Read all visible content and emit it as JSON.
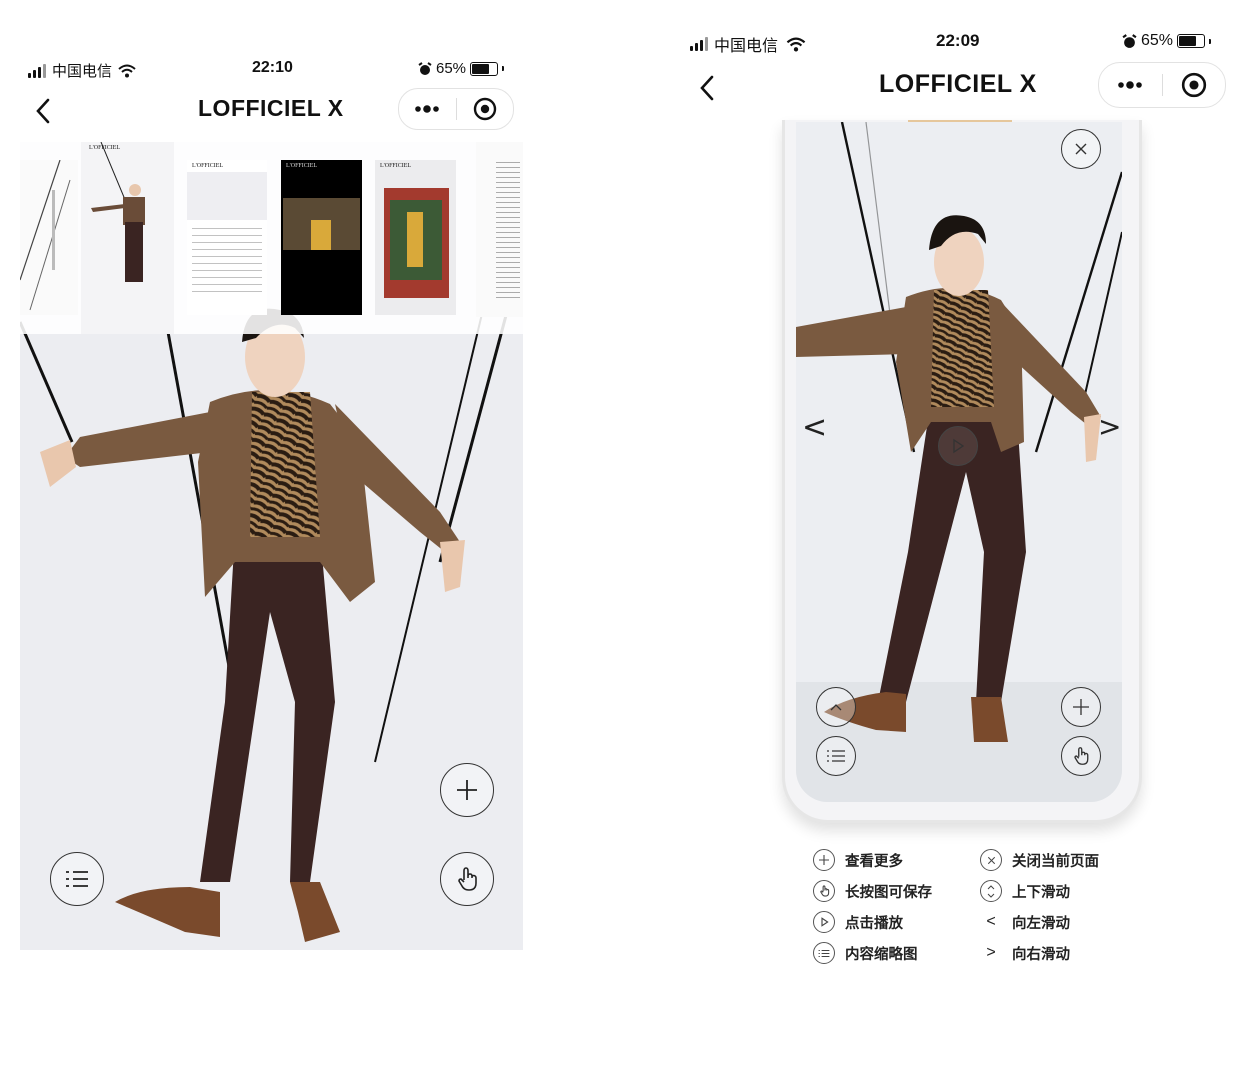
{
  "left": {
    "status": {
      "carrier": "中国电信",
      "time": "22:10",
      "battery": "65%",
      "battery_level": 0.65
    },
    "nav": {
      "title": "LOFFICIEL X"
    },
    "thumbnail_strip": {
      "pages": [
        {
          "label": "L'OFFICIEL"
        },
        {
          "label": "L'OFFICIEL"
        },
        {
          "label": "L'OFFICIEL"
        },
        {
          "label": "L'OFFICIEL"
        }
      ]
    },
    "controls": [
      "plus-button",
      "menu-button",
      "hand-save-button"
    ]
  },
  "right": {
    "status": {
      "carrier": "中国电信",
      "time": "22:09",
      "battery": "65%",
      "battery_level": 0.65
    },
    "nav": {
      "title": "LOFFICIEL X"
    },
    "arrows": {
      "left": "<",
      "right": ">"
    },
    "legend": {
      "left_col": [
        {
          "icon": "plus-icon",
          "label": "查看更多"
        },
        {
          "icon": "hand-icon",
          "label": "长按图可保存"
        },
        {
          "icon": "play-icon",
          "label": "点击播放"
        },
        {
          "icon": "list-icon",
          "label": "内容缩略图"
        }
      ],
      "right_col": [
        {
          "icon": "close-icon",
          "label": "关闭当前页面"
        },
        {
          "icon": "updown-icon",
          "label": "上下滑动"
        },
        {
          "icon": "<",
          "label": "向左滑动"
        },
        {
          "icon": ">",
          "label": "向右滑动"
        }
      ]
    }
  },
  "colors": {
    "jacket": "#7a5a40",
    "trousers": "#3a2422",
    "boots": "#7a4a2c",
    "bg": "#eceef3"
  }
}
